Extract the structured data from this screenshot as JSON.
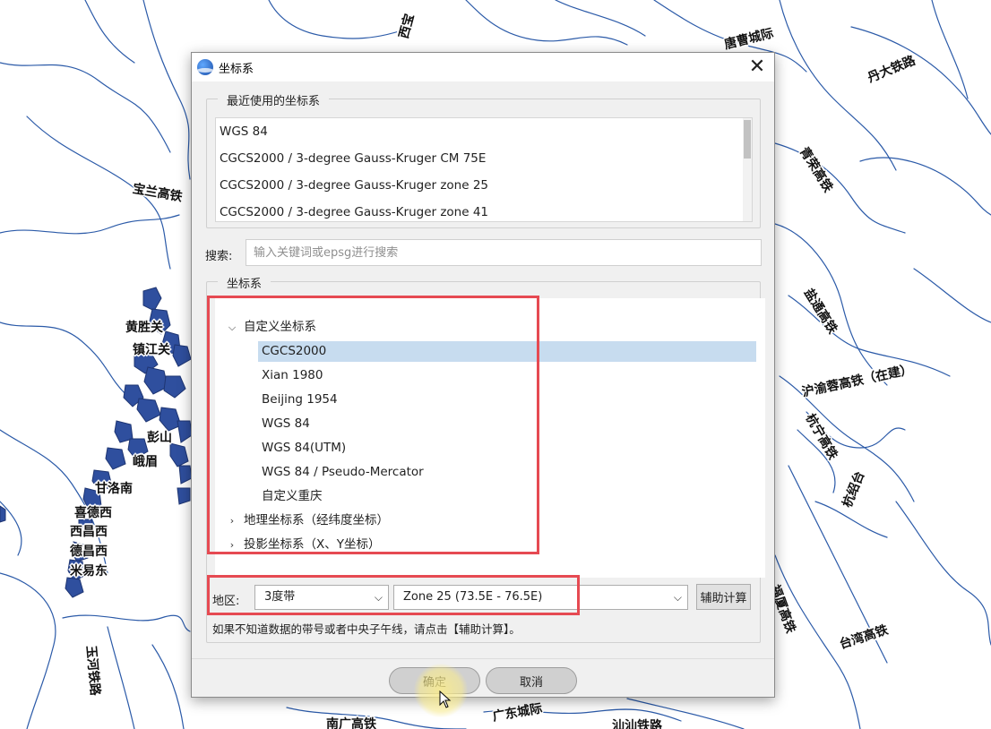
{
  "dialog": {
    "title": "坐标系",
    "app_icon": "app-globe-icon",
    "close_symbol": "✕",
    "recent_group_title": "最近使用的坐标系",
    "recent_items": [
      "WGS 84",
      "CGCS2000 / 3-degree Gauss-Kruger CM 75E",
      "CGCS2000 / 3-degree Gauss-Kruger zone 25",
      "CGCS2000 / 3-degree Gauss-Kruger zone 41"
    ],
    "search": {
      "label": "搜索:",
      "placeholder": "输入关键词或epsg进行搜索",
      "value": ""
    },
    "tree_group_title": "坐标系",
    "tree": {
      "custom_group": "自定义坐标系",
      "custom_items": [
        "CGCS2000",
        "Xian 1980",
        "Beijing 1954",
        "WGS 84",
        "WGS 84(UTM)",
        "WGS 84 / Pseudo-Mercator",
        "自定义重庆"
      ],
      "selected": "CGCS2000",
      "geo_group": "地理坐标系（经纬度坐标）",
      "proj_group": "投影坐标系（X、Y坐标）"
    },
    "region": {
      "label": "地区:",
      "band_value": "3度带",
      "zone_value": "Zone 25 (73.5E - 76.5E)",
      "assist_button": "辅助计算"
    },
    "hint": "如果不知道数据的带号或者中央子午线，请点击【辅助计算】。",
    "ok_button": "确定",
    "cancel_button": "取消",
    "highlight_color": "#e64a52",
    "selection_color": "#c7dcef"
  },
  "map": {
    "line_color": "#2b5aa8",
    "labels": [
      "唐曹城际",
      "丹大铁路",
      "宝兰高铁",
      "青荣高铁",
      "黄胜关",
      "镇江关",
      "彭山",
      "峨眉",
      "甘洛南",
      "喜德西",
      "西昌西",
      "德昌西",
      "米易东",
      "盐通高铁",
      "沪渝蓉高铁（在建）",
      "杭宁高铁",
      "杭绍台",
      "福厦高铁",
      "台湾高铁",
      "广东城际",
      "汕汕铁路",
      "南广高铁",
      "玉河铁路",
      "西宝"
    ]
  }
}
